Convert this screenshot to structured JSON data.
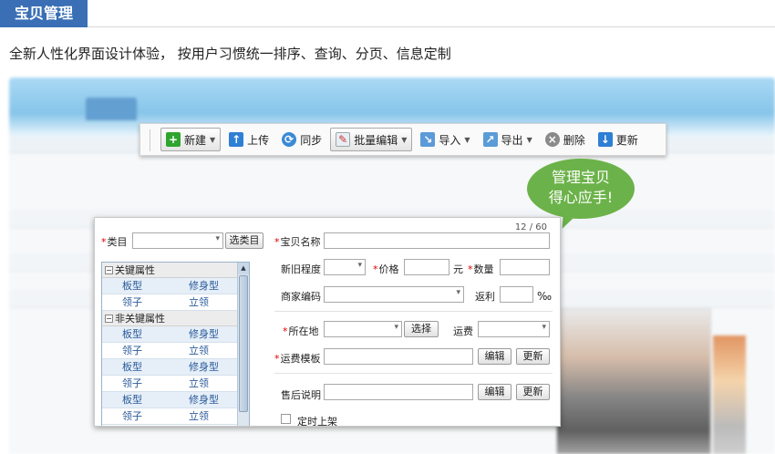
{
  "header": {
    "tag_title": "宝贝管理",
    "subtitle": "全新人性化界面设计体验， 按用户习惯统一排序、查询、分页、信息定制"
  },
  "toolbar": {
    "new_label": "新建",
    "upload_label": "上传",
    "sync_label": "同步",
    "batch_edit_label": "批量编辑",
    "import_label": "导入",
    "export_label": "导出",
    "delete_label": "删除",
    "update_label": "更新"
  },
  "bubble": {
    "line1": "管理宝贝",
    "line2": "得心应手!"
  },
  "dialog": {
    "counter": "12 / 60",
    "category_label": "类目",
    "choose_category_button": "选类目",
    "item_name_label": "宝贝名称",
    "condition_label": "新旧程度",
    "price_label": "价格",
    "price_unit": "元",
    "quantity_label": "数量",
    "merchant_code_label": "商家编码",
    "rebate_label": "返利",
    "rebate_unit": "‰",
    "location_label": "所在地",
    "select_button": "选择",
    "shipping_fee_label": "运费",
    "shipping_template_label": "运费模板",
    "edit_button": "编辑",
    "update_button": "更新",
    "after_sales_label": "售后说明",
    "edit_button_2": "编辑",
    "update_button_2": "更新",
    "scheduled_listing_label": "定时上架"
  },
  "tree": {
    "groups": [
      {
        "label": "关键属性",
        "rows": [
          [
            "板型",
            "修身型"
          ],
          [
            "领子",
            "立领"
          ]
        ]
      },
      {
        "label": "非关键属性",
        "rows": [
          [
            "板型",
            "修身型"
          ],
          [
            "领子",
            "立领"
          ],
          [
            "板型",
            "修身型"
          ],
          [
            "领子",
            "立领"
          ],
          [
            "板型",
            "修身型"
          ],
          [
            "领子",
            "立领"
          ]
        ]
      }
    ]
  },
  "colors": {
    "title_tag": "#3a6fb5",
    "bubble": "#6cb24a",
    "required_star": "#dd0000",
    "tree_text": "#2a5a9a"
  },
  "icons": {
    "new": "plus-icon",
    "upload": "upload-arrow-icon",
    "sync": "sync-icon",
    "batch_edit": "pencil-icon",
    "import": "import-icon",
    "export": "export-icon",
    "delete": "delete-x-icon",
    "update": "download-arrow-icon"
  }
}
